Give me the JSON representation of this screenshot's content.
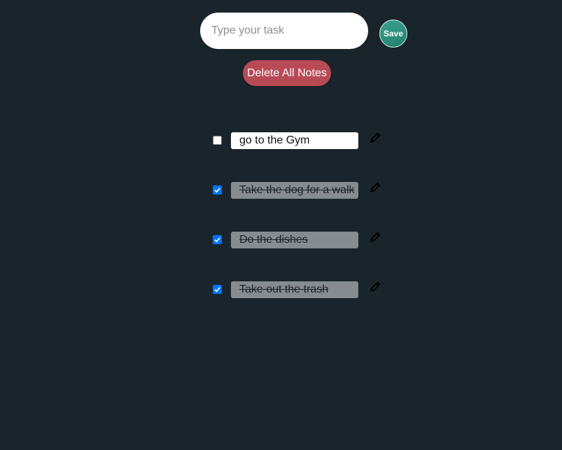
{
  "input": {
    "placeholder": "Type your task",
    "value": ""
  },
  "save_button": {
    "label": "Save",
    "color": "#2f9480"
  },
  "delete_all_button": {
    "label": "Delete All Notes",
    "color": "#b84a56"
  },
  "tasks": [
    {
      "text": "go to the Gym",
      "checked": false,
      "edit_icon": "pencil-icon"
    },
    {
      "text": "Take the dog for a walk",
      "checked": true,
      "edit_icon": "pencil-icon"
    },
    {
      "text": "Do the dishes",
      "checked": true,
      "edit_icon": "pencil-icon"
    },
    {
      "text": "Take out the trash",
      "checked": true,
      "edit_icon": "pencil-icon"
    }
  ],
  "colors": {
    "background": "#19252b",
    "checkbox_checked": "#0075ff",
    "done_task_bg": "#868c8f"
  }
}
